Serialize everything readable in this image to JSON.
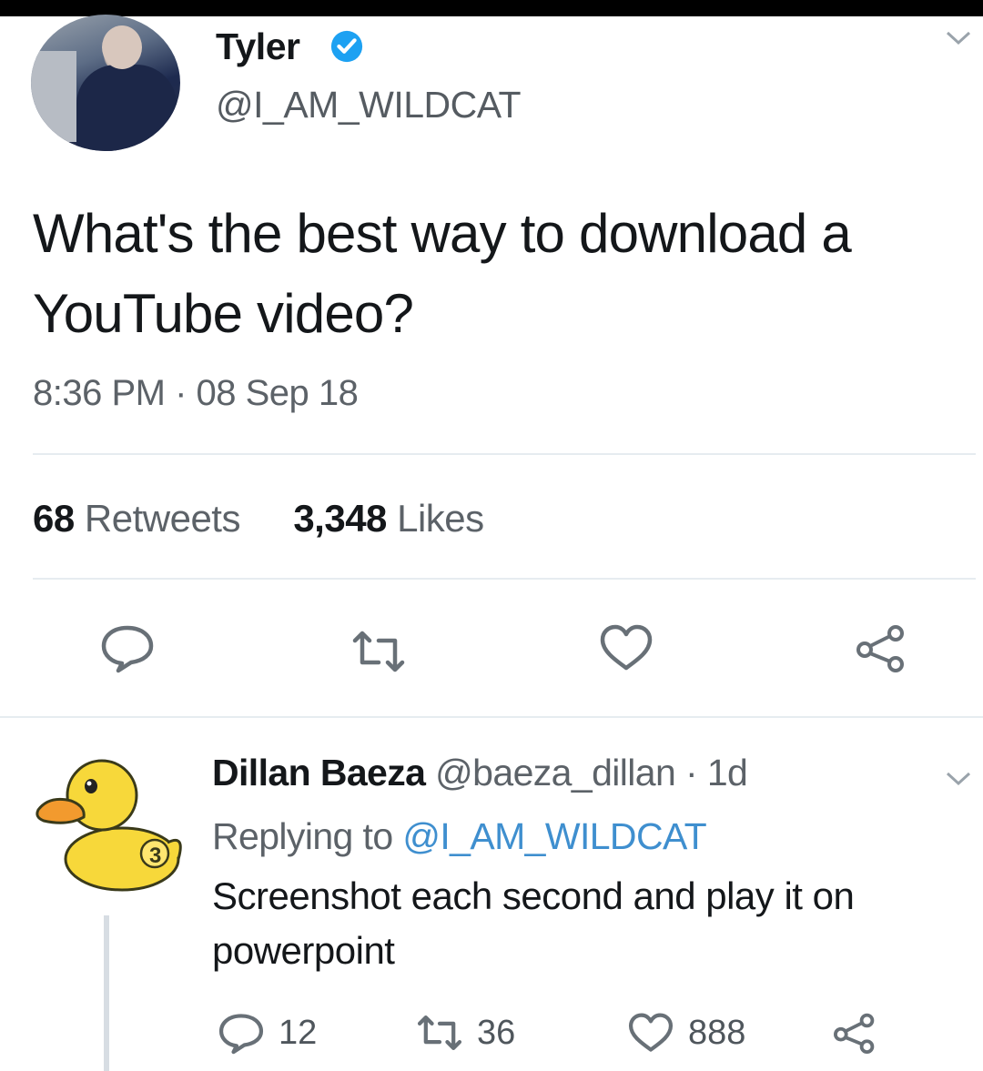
{
  "tweet": {
    "author_name": "Tyler",
    "author_handle": "@I_AM_WILDCAT",
    "text": "What's the best way to download a YouTube video?",
    "timestamp": "8:36 PM · 08 Sep 18",
    "retweets_count": "68",
    "retweets_label": "Retweets",
    "likes_count": "3,348",
    "likes_label": "Likes",
    "verified": true,
    "actions": [
      "reply-icon",
      "retweet-icon",
      "like-icon",
      "share-icon"
    ]
  },
  "reply": {
    "author_name": "Dillan Baeza",
    "author_handle": "@baeza_dillan · 1d",
    "replying_prefix": "Replying to",
    "replying_to": "@I_AM_WILDCAT",
    "text": "Screenshot each second and play it on powerpoint",
    "reply_count": "12",
    "retweet_count": "36",
    "like_count": "888"
  },
  "colors": {
    "verified_blue": "#1da1f2",
    "mention_blue": "#3f8fcf",
    "icon_gray": "#687077",
    "duck_yellow": "#f7d83a"
  }
}
